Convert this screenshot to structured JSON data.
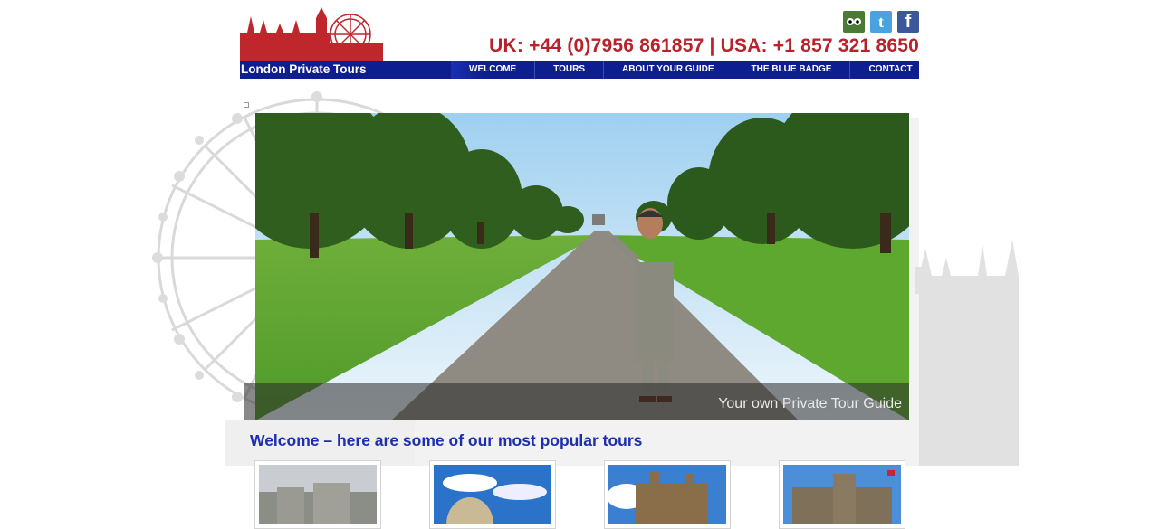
{
  "header": {
    "phone": "UK: +44 (0)7956 861857 | USA: +1 857 321 8650",
    "brand": "London Private Tours",
    "social": [
      "tripadvisor-icon",
      "twitter-icon",
      "facebook-icon"
    ]
  },
  "nav": {
    "items": [
      "WELCOME",
      "TOURS",
      "ABOUT YOUR GUIDE",
      "THE BLUE BADGE",
      "CONTACT"
    ],
    "active": "WELCOME"
  },
  "hero": {
    "caption": "Your own Private Tour Guide"
  },
  "main": {
    "welcome": "Welcome – here are some of our most popular tours"
  },
  "colors": {
    "accent_red": "#b8232b",
    "nav_blue": "#0e1d8f",
    "heading_blue": "#1d2fae"
  }
}
